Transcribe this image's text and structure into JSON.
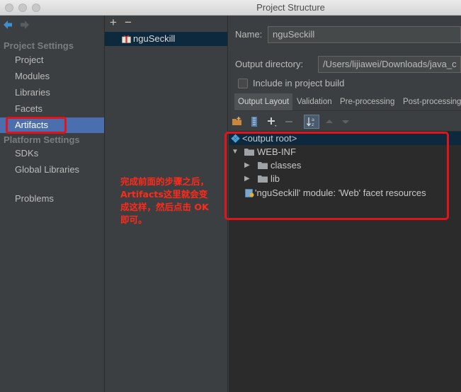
{
  "window": {
    "title": "Project Structure"
  },
  "nav": {
    "project_settings_header": "Project Settings",
    "platform_settings_header": "Platform Settings",
    "items": [
      {
        "label": "Project"
      },
      {
        "label": "Modules"
      },
      {
        "label": "Libraries"
      },
      {
        "label": "Facets"
      },
      {
        "label": "Artifacts",
        "selected": true
      },
      {
        "label": "SDKs"
      },
      {
        "label": "Global Libraries"
      },
      {
        "label": "Problems"
      }
    ]
  },
  "artifacts_list": {
    "add_label": "+",
    "remove_label": "−",
    "items": [
      {
        "label": "nguSeckill",
        "icon": "war-archive-icon"
      }
    ]
  },
  "detail": {
    "name_label": "Name:",
    "name_value": "nguSeckill",
    "output_dir_label": "Output directory:",
    "output_dir_value": "/Users/lijiawei/Downloads/java_c",
    "include_label": "Include in project build",
    "include_checked": false,
    "tabs": [
      {
        "label": "Output Layout",
        "active": true
      },
      {
        "label": "Validation"
      },
      {
        "label": "Pre-processing"
      },
      {
        "label": "Post-processing"
      }
    ]
  },
  "tree": {
    "rows": [
      {
        "label": "<output root>",
        "icon": "output-root-icon"
      },
      {
        "label": "WEB-INF",
        "icon": "folder-icon",
        "expanded": true
      },
      {
        "label": "classes",
        "icon": "folder-icon"
      },
      {
        "label": "lib",
        "icon": "folder-icon"
      },
      {
        "label": "'nguSeckill' module: 'Web' facet resources",
        "icon": "web-facet-icon"
      }
    ]
  },
  "annotation": {
    "lines": [
      "完成前面的步骤之后，",
      "Artifacts这里就会变",
      "成这样，然后点击 OK",
      "即可。"
    ]
  },
  "colors": {
    "background": "#3c3f41",
    "selection": "#4b6eaf",
    "tree_background": "#2b2b2b",
    "annotation_red": "#e0141b"
  }
}
